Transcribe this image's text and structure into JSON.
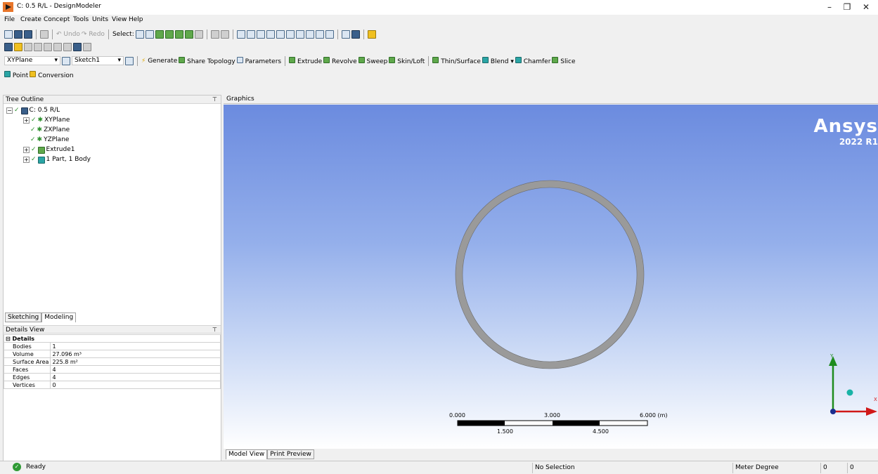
{
  "window": {
    "title": "C: 0.5 R/L - DesignModeler",
    "controls": [
      "–",
      "❐",
      "✕"
    ]
  },
  "menubar": [
    "File",
    "Create",
    "Concept",
    "Tools",
    "Units",
    "View",
    "Help"
  ],
  "toolbar1": {
    "undo": "Undo",
    "redo": "Redo",
    "select": "Select:"
  },
  "toolbar3": {
    "plane": "XYPlane",
    "sketch": "Sketch1",
    "generate": "Generate",
    "share_topology": "Share Topology",
    "parameters": "Parameters",
    "extrude": "Extrude",
    "revolve": "Revolve",
    "sweep": "Sweep",
    "skin_loft": "Skin/Loft",
    "thin_surface": "Thin/Surface",
    "blend": "Blend",
    "chamfer": "Chamfer",
    "slice": "Slice"
  },
  "toolbar4": {
    "point": "Point",
    "conversion": "Conversion"
  },
  "tree_outline": {
    "header": "Tree Outline",
    "root": "C: 0.5 R/L",
    "items": [
      "XYPlane",
      "ZXPlane",
      "YZPlane",
      "Extrude1",
      "1 Part, 1 Body"
    ]
  },
  "left_tabs": [
    "Sketching",
    "Modeling"
  ],
  "details_view": {
    "header": "Details View",
    "section": "Details",
    "rows": [
      {
        "label": "Bodies",
        "value": "1"
      },
      {
        "label": "Volume",
        "value": "27.096 m³"
      },
      {
        "label": "Surface Area",
        "value": "225.8 m²"
      },
      {
        "label": "Faces",
        "value": "4"
      },
      {
        "label": "Edges",
        "value": "4"
      },
      {
        "label": "Vertices",
        "value": "0"
      }
    ]
  },
  "graphics": {
    "header": "Graphics",
    "brand": "Ansys",
    "version": "2022 R1",
    "scale_labels_top": [
      "0.000",
      "3.000",
      "6.000 (m)"
    ],
    "scale_labels_bottom": [
      "1.500",
      "4.500"
    ],
    "axis_y": "Y",
    "axis_x": "X"
  },
  "view_tabs": [
    "Model View",
    "Print Preview"
  ],
  "status": {
    "ready": "Ready",
    "selection": "No Selection",
    "units": "Meter  Degree",
    "field1": "0",
    "field2": "0"
  },
  "colors": {
    "ring": "#9a9a9a",
    "bg_top": "#6b8bdf",
    "bg_bottom": "#ffffff"
  }
}
